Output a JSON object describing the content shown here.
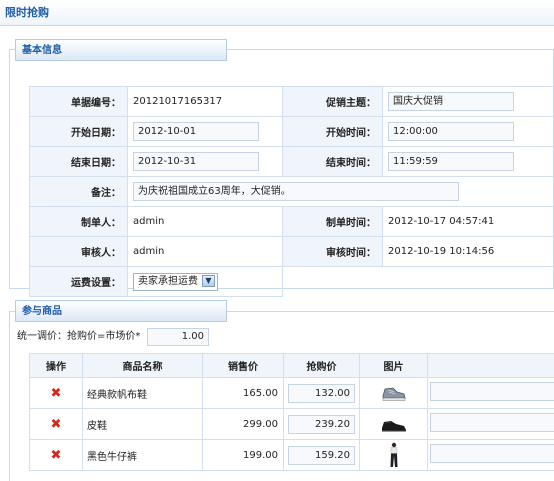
{
  "page": {
    "title": "限时抢购"
  },
  "basic_section": {
    "legend": "基本信息",
    "rows": [
      {
        "label1": "单据编号：",
        "value1": "20121017165317",
        "label2": "促销主题：",
        "value2": "国庆大促销"
      },
      {
        "label1": "开始日期：",
        "value1": "2012-10-01",
        "label2": "开始时间：",
        "value2": "12:00:00"
      },
      {
        "label1": "结束日期：",
        "value1": "2012-10-31",
        "label2": "结束时间：",
        "value2": "11:59:59"
      }
    ],
    "remark": {
      "label": "备注：",
      "value": "为庆祝祖国成立63周年，大促销。"
    },
    "maker": {
      "label": "制单人：",
      "value": "admin",
      "time_label": "制单时间：",
      "time_value": "2012-10-17 04:57:41"
    },
    "auditor": {
      "label": "审核人：",
      "value": "admin",
      "time_label": "审核时间：",
      "time_value": "2012-10-19 10:14:56"
    },
    "shipping": {
      "label": "运费设置：",
      "selected": "卖家承担运费"
    }
  },
  "goods_section": {
    "legend": "参与商品",
    "adjust_label": "统一调价：抢购价=市场价*",
    "adjust_value": "1.00",
    "headers": {
      "op": "操作",
      "name": "商品名称",
      "price": "销售价",
      "flash": "抢购价",
      "image": "图片"
    },
    "items": [
      {
        "name": "经典款帆布鞋",
        "price": "165.00",
        "flash_price": "132.00",
        "image_icon": "canvas-shoe-icon"
      },
      {
        "name": "皮鞋",
        "price": "299.00",
        "flash_price": "239.20",
        "image_icon": "leather-shoe-icon"
      },
      {
        "name": "黑色牛仔裤",
        "price": "199.00",
        "flash_price": "159.20",
        "image_icon": "jeans-icon"
      }
    ]
  },
  "colors": {
    "accent": "#1f5ea8",
    "delete": "#d9261c",
    "label_bg": "#f0f5fb",
    "border": "#d3dfee"
  }
}
